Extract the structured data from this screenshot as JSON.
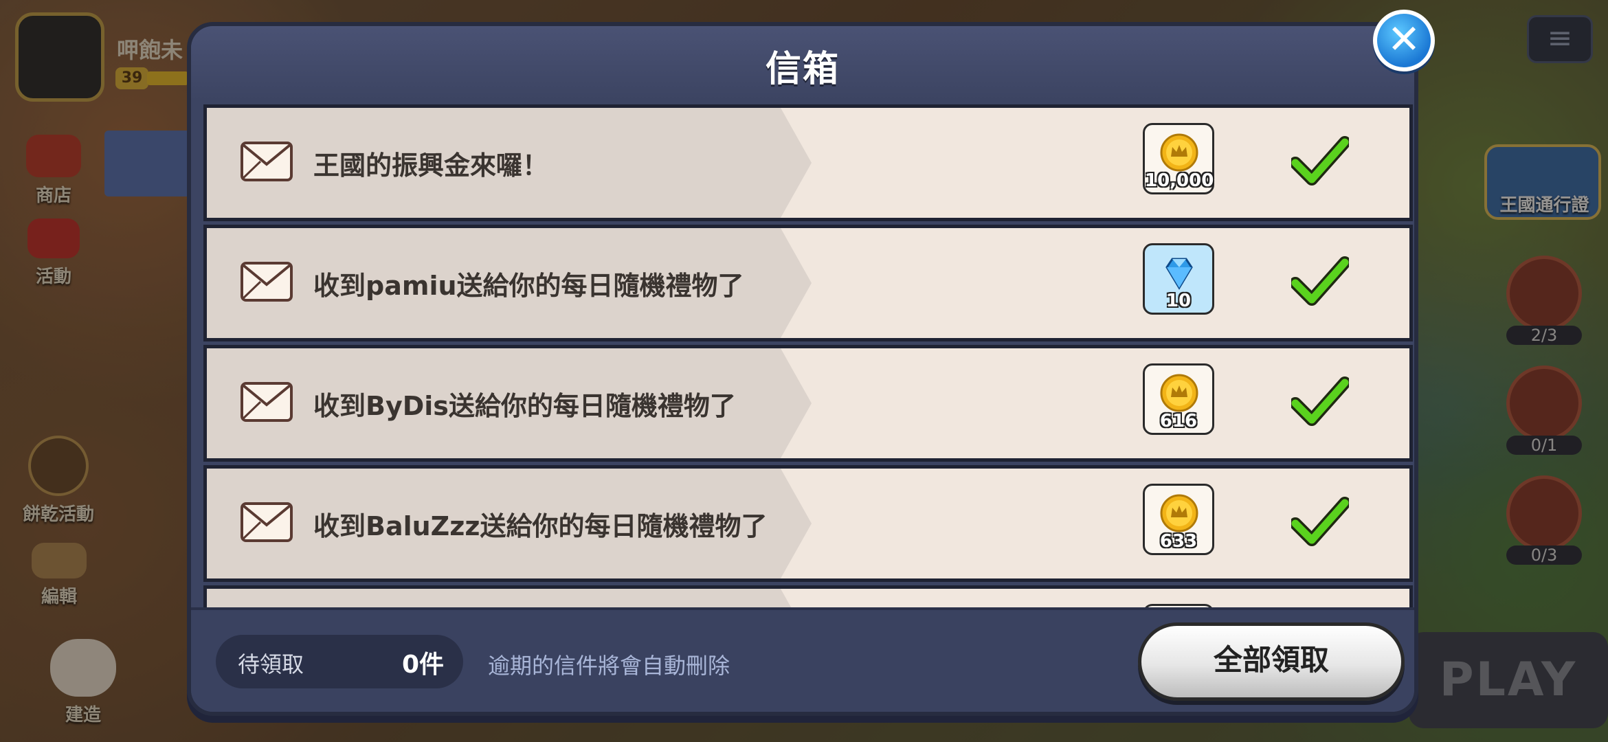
{
  "background": {
    "player_name": "呷飽未",
    "player_level": "39",
    "left_menu": [
      {
        "label": "商店",
        "icon": "shop-icon"
      },
      {
        "label": "活動",
        "icon": "gift-icon"
      },
      {
        "label": "餅乾活動",
        "icon": "cookie-icon"
      },
      {
        "label": "編輯",
        "icon": "edit-icon"
      },
      {
        "label": "建造",
        "icon": "build-icon"
      }
    ],
    "right_menu": {
      "kingdom_pass": "王國通行證",
      "counters": [
        "2/3",
        "0/1",
        "0/3"
      ]
    },
    "play_label": "PLAY"
  },
  "mailbox": {
    "title": "信箱",
    "close_icon": "close-icon",
    "mails": [
      {
        "text": "王國的振興金來囉！",
        "reward_type": "coin",
        "amount": "10,000"
      },
      {
        "text": "收到pamiu送給你的每日隨機禮物了",
        "reward_type": "gem",
        "amount": "10"
      },
      {
        "text": "收到ByDis送給你的每日隨機禮物了",
        "reward_type": "coin",
        "amount": "616"
      },
      {
        "text": "收到BaluZzz送給你的每日隨機禮物了",
        "reward_type": "coin",
        "amount": "633"
      }
    ],
    "pending_label": "待領取",
    "pending_count": "0件",
    "expire_note": "逾期的信件將會自動刪除",
    "claim_all_label": "全部領取"
  },
  "colors": {
    "dialog_bg": "#3c4462",
    "row_bg": "#f1e7de",
    "check_green": "#5ad21e",
    "coin_gold": "#f2b417",
    "gem_blue": "#2f9ae8"
  }
}
